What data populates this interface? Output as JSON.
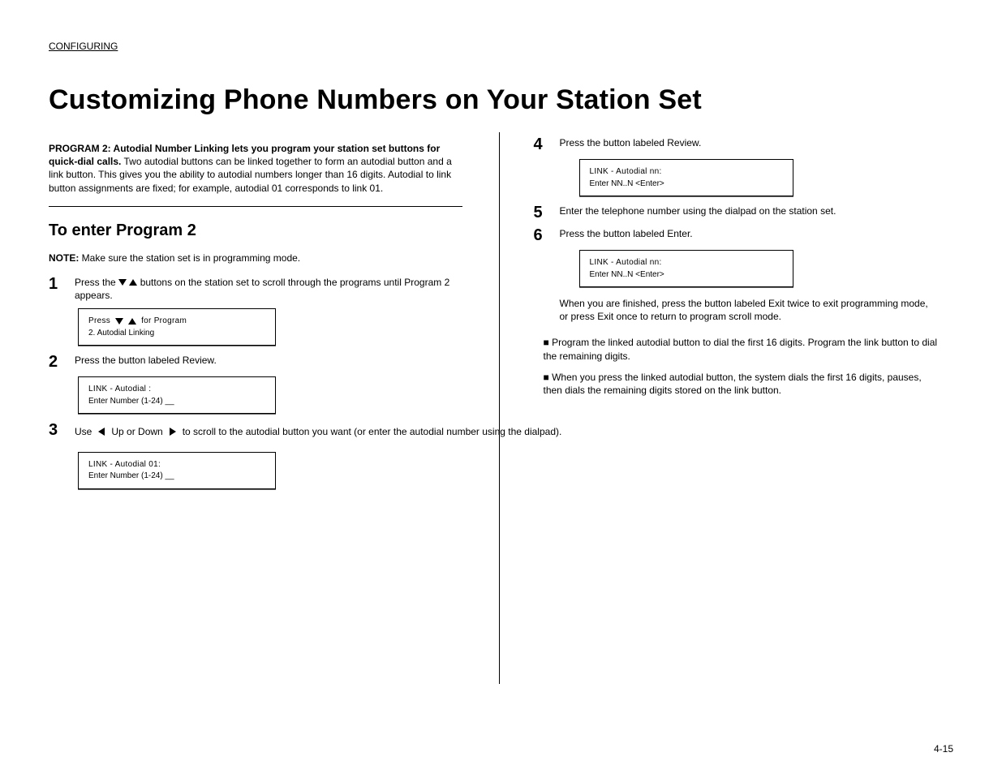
{
  "section_label": "CONFIGURING",
  "main_title": "Customizing Phone Numbers on Your Station Set",
  "left": {
    "intro_bold": "PROGRAM 2: Autodial Number Linking lets you program your station set buttons for quick-dial calls.",
    "intro_rest": " Two autodial buttons can be linked together to form an autodial button and a link button. This gives you the ability to autodial numbers longer than 16 digits. Autodial to link button assignments are fixed; for example, autodial 01 corresponds to link 01.",
    "sub_heading": "To enter Program 2",
    "note_strong": "NOTE:",
    "note_text": " Make sure the station set is in programming mode.",
    "step1_num": "1",
    "step1_text_a": "Press the ",
    "step1_text_b": " buttons on the station set to scroll through the programs until Program 2 appears.",
    "box1_l1_pre": "Press",
    "box1_l1_post": " for Program",
    "box1_l2": "2.  Autodial Linking",
    "step2_num": "2",
    "step2_text": "Press the button labeled Review.",
    "box2_l1": "LINK - Autodial   :",
    "box2_l2": "Enter Number (1-24)  __",
    "step3_num": "3",
    "step3_text_a": "Use ",
    "step3_text_b": " Up or Down ",
    "step3_text_c": " to scroll to the autodial button you want (or enter the autodial number using the dialpad).",
    "box3_l1": "LINK - Autodial 01:",
    "box3_l2": "Enter Number (1-24)  __"
  },
  "right": {
    "step4_num": "4",
    "step4_text": "Press the button labeled Review.",
    "box4_l1": "LINK - Autodial nn:",
    "box4_l2": "Enter NN..N <Enter>",
    "step5_num": "5",
    "step5_text": "Enter the telephone number using the dialpad on the station set.",
    "step6_num": "6",
    "step6_text": "Press the button labeled Enter.",
    "box6_l1": "LINK - Autodial nn:",
    "box6_l2": "Enter NN..N <Enter>",
    "finish_a": "When you are finished, press the button labeled Exit twice to exit programming mode, or press ",
    "finish_b": "Exit",
    "finish_c": " once to return to program scroll mode.",
    "extra_prefix": "■  ",
    "extra_a": "Program the linked autodial button to dial the first 16 digits. Program the link button to dial the remaining digits.",
    "bullet_prefix": "■  ",
    "bullet_b": "When you press the linked autodial button, the system dials the first 16 digits, pauses, then dials the remaining digits stored on the link button."
  },
  "page_number": "4-15"
}
